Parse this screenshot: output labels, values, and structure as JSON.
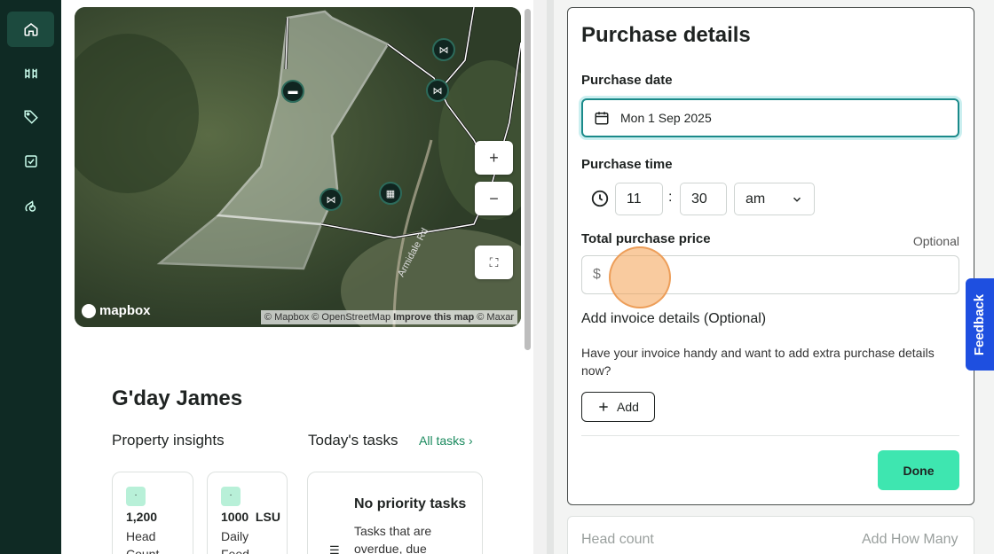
{
  "sidebar": {
    "items": [
      {
        "icon": "home-icon",
        "active": true
      },
      {
        "icon": "paddocks-icon"
      },
      {
        "icon": "tag-icon"
      },
      {
        "icon": "tasks-icon"
      },
      {
        "icon": "feed-icon"
      }
    ]
  },
  "map": {
    "zoom_in": "+",
    "zoom_out": "−",
    "fullscreen": "⛶",
    "logo": "mapbox",
    "attribution_1": "© Mapbox © OpenStreetMap ",
    "attribution_improve": "Improve this map",
    "attribution_2": " © Maxar",
    "road_label": "Armidale Rd"
  },
  "home": {
    "greeting": "G'day James",
    "insights_title": "Property insights",
    "tasks_title": "Today's tasks",
    "all_tasks": "All tasks",
    "cards": [
      {
        "value": "1,200",
        "label": "Head Count"
      },
      {
        "value": "1000  LSU",
        "label": "Daily Feed"
      }
    ],
    "tasks_card": {
      "title": "No priority tasks",
      "desc": "Tasks that are overdue, due"
    }
  },
  "form": {
    "title": "Purchase details",
    "date_label": "Purchase date",
    "date_value": "Mon 1 Sep 2025",
    "time_label": "Purchase time",
    "hour": "11",
    "minute": "30",
    "colon": ":",
    "ampm": "am",
    "price_label": "Total purchase price",
    "optional": "Optional",
    "currency": "$",
    "invoice_heading": "Add invoice details (Optional)",
    "invoice_desc": "Have your invoice handy and want to add extra purchase details now?",
    "add_label": "Add",
    "done_label": "Done",
    "head_count_label": "Head count",
    "head_count_action": "Add How Many"
  },
  "feedback": "Feedback",
  "colors": {
    "sidebar": "#0f2a24",
    "accent": "#3ee6b0",
    "focus": "#1a8a8a",
    "feedback": "#1e4fe0"
  }
}
